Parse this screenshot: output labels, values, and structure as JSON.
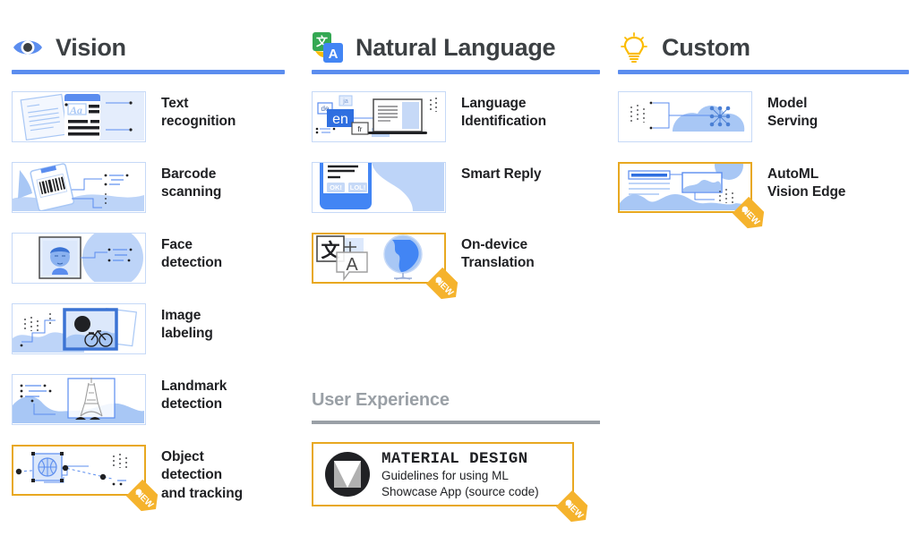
{
  "colors": {
    "accent_blue": "#5b8def",
    "light_blue": "#a8c7f5",
    "pale_blue": "#c6d9f7",
    "new_orange": "#f5b32d",
    "new_border": "#e8a820",
    "gray_heading": "#9aa0a6",
    "text_dark": "#202124"
  },
  "sections": {
    "vision": {
      "title": "Vision",
      "icon": "eye-icon",
      "features": [
        {
          "label_lines": [
            "Text",
            "recognition"
          ],
          "art": "text-recognition-art",
          "is_new": false
        },
        {
          "label_lines": [
            "Barcode",
            "scanning"
          ],
          "art": "barcode-scanning-art",
          "is_new": false
        },
        {
          "label_lines": [
            "Face",
            "detection"
          ],
          "art": "face-detection-art",
          "is_new": false
        },
        {
          "label_lines": [
            "Image",
            "labeling"
          ],
          "art": "image-labeling-art",
          "is_new": false
        },
        {
          "label_lines": [
            "Landmark",
            "detection"
          ],
          "art": "landmark-detection-art",
          "is_new": false
        },
        {
          "label_lines": [
            "Object",
            "detection",
            "and tracking"
          ],
          "art": "object-detection-art",
          "is_new": true
        }
      ]
    },
    "natural_language": {
      "title": "Natural Language",
      "icon": "translate-icon",
      "features": [
        {
          "label_lines": [
            "Language",
            "Identification"
          ],
          "art": "language-identification-art",
          "is_new": false
        },
        {
          "label_lines": [
            "Smart Reply"
          ],
          "art": "smart-reply-art",
          "is_new": false
        },
        {
          "label_lines": [
            "On-device",
            "Translation"
          ],
          "art": "on-device-translation-art",
          "is_new": true
        }
      ]
    },
    "custom": {
      "title": "Custom",
      "icon": "lightbulb-icon",
      "features": [
        {
          "label_lines": [
            "Model",
            "Serving"
          ],
          "art": "model-serving-art",
          "is_new": false
        },
        {
          "label_lines": [
            "AutoML",
            "Vision Edge"
          ],
          "art": "automl-vision-edge-art",
          "is_new": true
        }
      ]
    }
  },
  "user_experience": {
    "title": "User Experience",
    "card": {
      "title": "MATERIAL DESIGN",
      "subtitle_lines": [
        "Guidelines for using ML",
        "Showcase App (source code)"
      ],
      "logo": "material-design-logo",
      "is_new": true
    }
  },
  "badges": {
    "new_label": "NEW"
  },
  "art_text": {
    "text_recognition_sample": "Aa",
    "language_tags": [
      "de",
      "ja",
      "en",
      "fr"
    ],
    "smart_reply_chips": [
      "OK!",
      "LOL!"
    ],
    "translation_glyphs": [
      "文",
      "A"
    ]
  }
}
